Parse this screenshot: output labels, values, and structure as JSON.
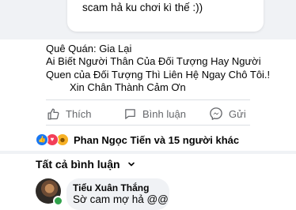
{
  "quoted_comment": {
    "text": "scam hả ku chơi kì thế :))"
  },
  "post": {
    "lines": [
      "Quê Quán: Gia Lại",
      "Ai Biết Người  Thân Của Đối Tượng Hay Người",
      "Quen của Đối Tượng Thì Liên Hệ Ngay Chô Tôi.!",
      "Xin Chân Thành Cảm Ơn"
    ]
  },
  "actions": {
    "like": "Thích",
    "comment": "Bình luận",
    "send": "Gửi"
  },
  "reactions": {
    "icons": [
      "like-icon",
      "love-icon",
      "haha-icon"
    ],
    "summary": "Phan Ngọc Tiến và 15 người khác"
  },
  "comments_filter": {
    "label": "Tất cả bình luận"
  },
  "comments": [
    {
      "author": "Tiểu Xuân Thắng",
      "text": "Sờ cam mợ hả @@"
    }
  ],
  "colors": {
    "brand_blue": "#1877f2",
    "love_red": "#f33e58",
    "haha_yellow": "#f7b125",
    "online_green": "#31a24c",
    "secondary_text": "#65676b",
    "bubble_bg": "#f0f2f5"
  }
}
